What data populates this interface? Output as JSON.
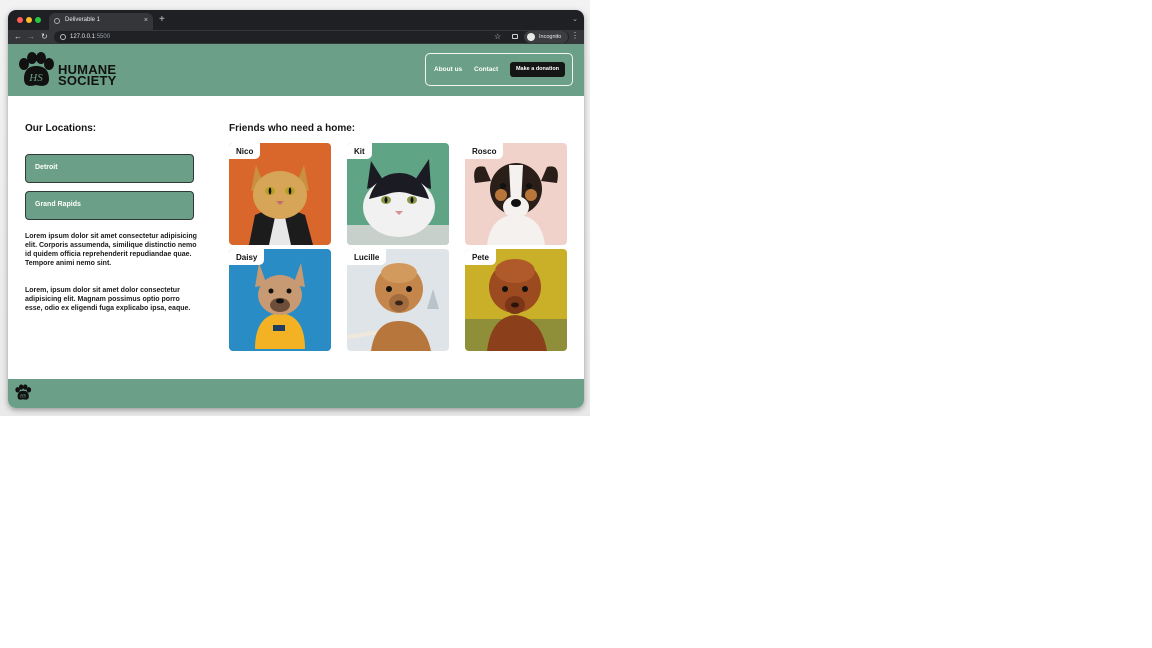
{
  "browser": {
    "tab_title": "Deliverable 1",
    "url_host": "127.0.0.1",
    "url_port": ":5500",
    "incognito_label": "Incognito"
  },
  "header": {
    "logo_line1": "HUMANE",
    "logo_line2": "SOCIETY",
    "nav_about": "About us",
    "nav_contact": "Contact",
    "donate": "Make a donation"
  },
  "locations": {
    "heading": "Our Locations:",
    "items": [
      "Detroit",
      "Grand Rapids"
    ]
  },
  "about": {
    "p1": "Lorem ipsum dolor sit amet consectetur adipisicing elit. Corporis assumenda, similique distinctio nemo id quidem officia reprehenderit repudiandae quae. Tempore animi nemo sint.",
    "p2": "Lorem, ipsum dolor sit amet dolor consectetur adipisicing elit. Magnam possimus optio porro esse, odio ex eligendi fuga explicabo ipsa, eaque."
  },
  "friends": {
    "heading": "Friends who need a home:",
    "pets": [
      {
        "name": "Nico",
        "animal": "cat",
        "bg": "#d9672b"
      },
      {
        "name": "Kit",
        "animal": "cat",
        "bg": "#5fa585"
      },
      {
        "name": "Rosco",
        "animal": "dog",
        "bg": "#f0d2cb"
      },
      {
        "name": "Daisy",
        "animal": "dog",
        "bg": "#2a8cc4"
      },
      {
        "name": "Lucille",
        "animal": "alpaca",
        "bg": "#dfe4e8"
      },
      {
        "name": "Pete",
        "animal": "alpaca",
        "bg": "#c9b028"
      }
    ]
  },
  "colors": {
    "brand_green": "#6b9f87",
    "dark": "#151515"
  }
}
